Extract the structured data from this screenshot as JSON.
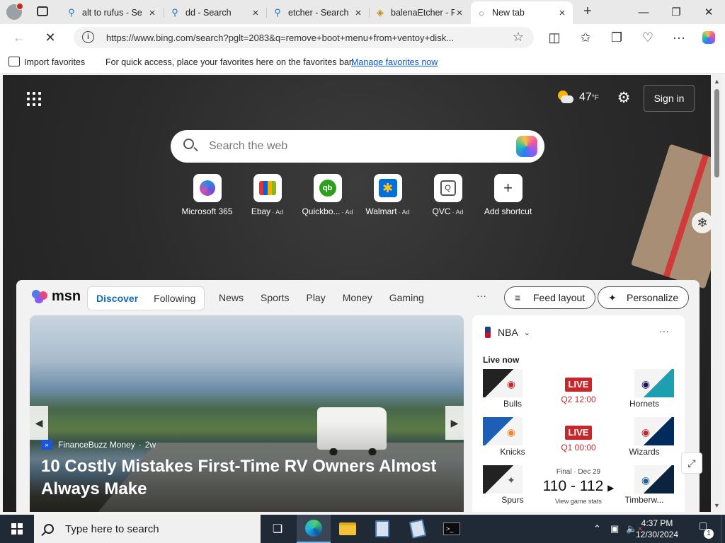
{
  "browser": {
    "tabs": [
      {
        "label": "alt to rufus - Se",
        "icon": "search-icon",
        "active": false
      },
      {
        "label": "dd - Search",
        "icon": "search-icon",
        "active": false
      },
      {
        "label": "etcher - Search",
        "icon": "search-icon",
        "active": false
      },
      {
        "label": "balenaEtcher - F",
        "icon": "balena-icon",
        "active": false
      },
      {
        "label": "New tab",
        "icon": "new-tab-icon",
        "active": true
      }
    ],
    "address": "https://www.bing.com/search?pglt=2083&q=remove+boot+menu+from+ventoy+disk...",
    "favorites_bar": {
      "import_label": "Import favorites",
      "message": "For quick access, place your favorites here on the favorites bar.",
      "manage_link": "Manage favorites now"
    }
  },
  "newtab": {
    "weather": {
      "temp": "47",
      "unit": "°F",
      "icon": "partly-cloudy-icon"
    },
    "signin_label": "Sign in",
    "search_placeholder": "Search the web",
    "shortcuts": [
      {
        "label": "Microsoft 365",
        "ad": "",
        "icon": "m365-icon"
      },
      {
        "label": "Ebay",
        "ad": "· Ad",
        "icon": "ebay-icon"
      },
      {
        "label": "Quickbo...",
        "ad": "· Ad",
        "icon": "quickbooks-icon",
        "logo_text": "qb"
      },
      {
        "label": "Walmart",
        "ad": "· Ad",
        "icon": "walmart-icon",
        "logo_text": "✱"
      },
      {
        "label": "QVC",
        "ad": "· Ad",
        "icon": "qvc-icon",
        "logo_text": "Q"
      },
      {
        "label": "Add shortcut",
        "ad": "",
        "icon": "plus-icon",
        "logo_text": "+"
      }
    ]
  },
  "msn": {
    "logo_text": "msn",
    "tabs": [
      "Discover",
      "Following"
    ],
    "active_tab": "Discover",
    "nav": [
      "News",
      "Sports",
      "Play",
      "Money",
      "Gaming"
    ],
    "more": "···",
    "feed_layout_label": "Feed layout",
    "personalize_label": "Personalize",
    "hero": {
      "source": "FinanceBuzz Money",
      "age": "2w",
      "headline": "10 Costly Mistakes First-Time RV Owners Almost Always Make"
    },
    "nba": {
      "title": "NBA",
      "live_label": "Live now",
      "games": [
        {
          "home": "Bulls",
          "away": "Hornets",
          "status": "LIVE",
          "clock": "Q2 12:00",
          "home_color": "#c4272c",
          "away_color": "#1d9fb0"
        },
        {
          "home": "Knicks",
          "away": "Wizards",
          "status": "LIVE",
          "clock": "Q1 00:00",
          "home_color": "#f58426",
          "away_color": "#002b5c"
        },
        {
          "home": "Spurs",
          "away": "Timberw...",
          "final": "Final · Dec 29",
          "score": "110 - 112",
          "stats_label": "View game stats",
          "home_color": "#7a7a7a",
          "away_color": "#0c2340"
        }
      ]
    }
  },
  "taskbar": {
    "search_placeholder": "Type here to search",
    "time": "4:37 PM",
    "date": "12/30/2024",
    "notification_count": "1"
  }
}
